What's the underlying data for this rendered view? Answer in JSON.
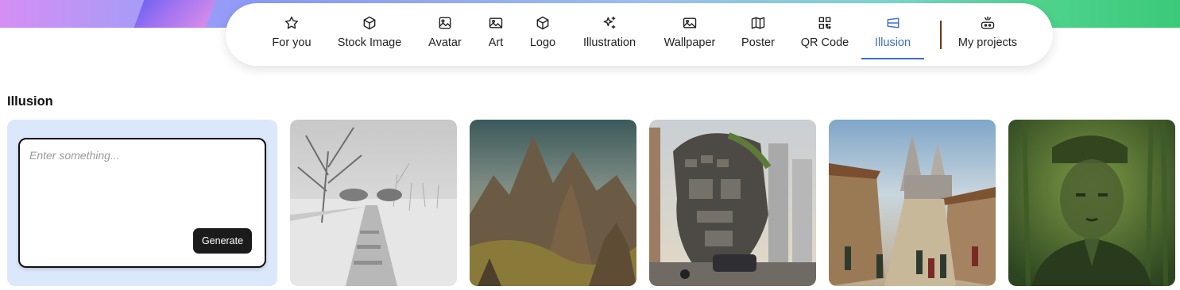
{
  "nav": {
    "items": [
      {
        "label": "For you",
        "icon": "star-icon"
      },
      {
        "label": "Stock Image",
        "icon": "cube-icon"
      },
      {
        "label": "Avatar",
        "icon": "image-frame-icon"
      },
      {
        "label": "Art",
        "icon": "image-icon"
      },
      {
        "label": "Logo",
        "icon": "cube-icon"
      },
      {
        "label": "Illustration",
        "icon": "sparkles-icon"
      },
      {
        "label": "Wallpaper",
        "icon": "image-icon"
      },
      {
        "label": "Poster",
        "icon": "map-icon"
      },
      {
        "label": "QR Code",
        "icon": "qr-code-icon"
      },
      {
        "label": "Illusion",
        "icon": "illusion-icon"
      },
      {
        "label": "My projects",
        "icon": "projects-icon"
      }
    ],
    "active": "Illusion",
    "accent_color": "#3b6cd6"
  },
  "section": {
    "title": "Illusion"
  },
  "prompt": {
    "placeholder": "Enter something...",
    "value": "",
    "generate_label": "Generate"
  },
  "gallery": {
    "images": [
      {
        "subject": "snowy park path"
      },
      {
        "subject": "rocky mountain landscape"
      },
      {
        "subject": "building shaped like a face"
      },
      {
        "subject": "medieval village street with castle"
      },
      {
        "subject": "portrait hidden in forest"
      }
    ]
  }
}
